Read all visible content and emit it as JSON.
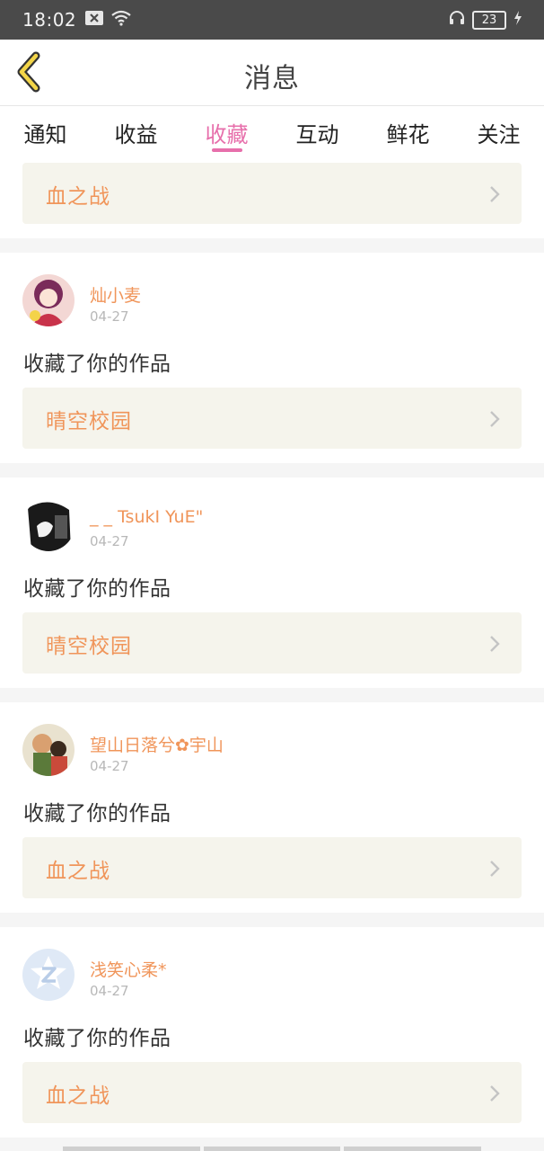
{
  "status_bar": {
    "time": "18:02",
    "battery": "23"
  },
  "header": {
    "title": "消息"
  },
  "tabs": [
    {
      "label": "通知"
    },
    {
      "label": "收益"
    },
    {
      "label": "收藏",
      "active": true
    },
    {
      "label": "互动"
    },
    {
      "label": "鲜花"
    },
    {
      "label": "关注"
    }
  ],
  "first_work": {
    "title": "血之战"
  },
  "messages": [
    {
      "user": "灿小麦",
      "date": "04-27",
      "action": "收藏了你的作品",
      "work": "晴空校园"
    },
    {
      "user": "_ _ TsukI YuE\"",
      "date": "04-27",
      "action": "收藏了你的作品",
      "work": "晴空校园"
    },
    {
      "user": "望山日落兮✿宇山",
      "date": "04-27",
      "action": "收藏了你的作品",
      "work": "血之战"
    },
    {
      "user": "浅笑心柔*",
      "date": "04-27",
      "action": "收藏了你的作品",
      "work": "血之战"
    }
  ],
  "colors": {
    "accent_pink": "#e76fab",
    "name_orange": "#f0955a",
    "back_yellow": "#f3d548"
  },
  "icons": [
    "back-arrow-icon",
    "chevron-right-icon",
    "wifi-icon",
    "headphone-icon",
    "charging-icon"
  ]
}
